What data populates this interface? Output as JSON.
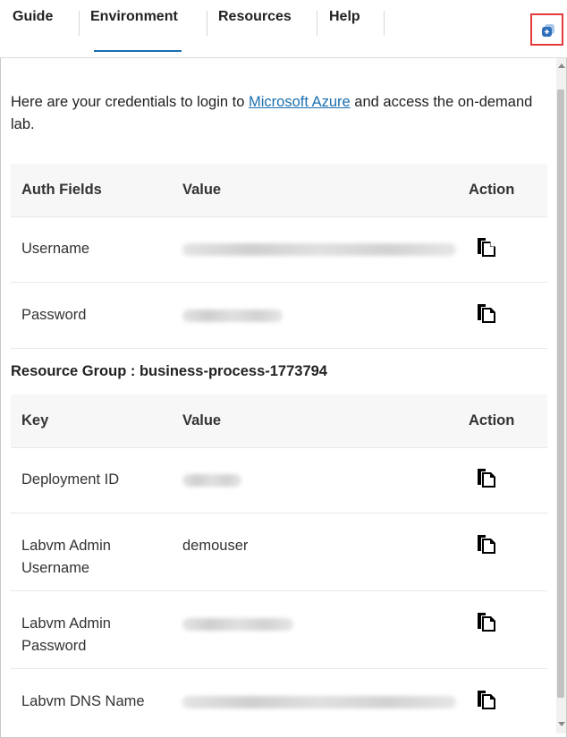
{
  "tabs": [
    {
      "label": "Guide"
    },
    {
      "label": "Environment"
    },
    {
      "label": "Resources"
    },
    {
      "label": "Help"
    }
  ],
  "intro": {
    "before": "Here are your credentials to login to ",
    "link": "Microsoft Azure",
    "after": " and access the on-demand lab."
  },
  "auth_table": {
    "headers": [
      "Auth Fields",
      "Value",
      "Action"
    ],
    "rows": [
      {
        "field": "Username",
        "value": ""
      },
      {
        "field": "Password",
        "value": ""
      }
    ]
  },
  "resource_group": {
    "title": "Resource Group : business-process-1773794"
  },
  "resource_table": {
    "headers": [
      "Key",
      "Value",
      "Action"
    ],
    "rows": [
      {
        "key": "Deployment ID",
        "value": ""
      },
      {
        "key": "Labvm Admin",
        "key2": "Username",
        "value": "demouser"
      },
      {
        "key": "Labvm Admin",
        "key2": "Password",
        "value": ""
      },
      {
        "key": "Labvm DNS Name",
        "value": ""
      }
    ]
  },
  "colors": {
    "accent": "#1a6fb0",
    "highlight": "#e33b3b",
    "icon_blue": "#2f6fba"
  },
  "icons": {
    "copy": "copy-icon",
    "open": "open-in-new-icon"
  }
}
